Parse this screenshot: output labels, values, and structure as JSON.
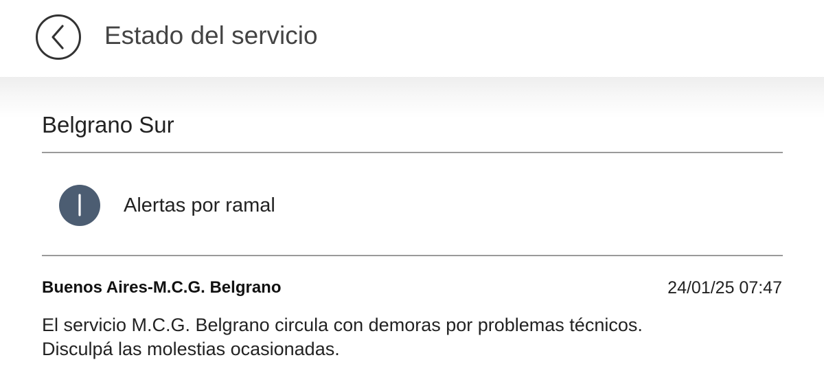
{
  "header": {
    "title": "Estado del servicio",
    "back_icon": "chevron-left-circle-icon"
  },
  "line": {
    "name": "Belgrano Sur"
  },
  "alerts_entry": {
    "label": "Alertas por ramal",
    "icon": "info-icon",
    "icon_color": "#4c5d72"
  },
  "alert": {
    "route": "Buenos Aires-M.C.G. Belgrano",
    "timestamp": "24/01/25 07:47",
    "message_lines": [
      "El servicio M.C.G. Belgrano circula con demoras por problemas técnicos.",
      "Disculpá las molestias ocasionadas."
    ]
  }
}
